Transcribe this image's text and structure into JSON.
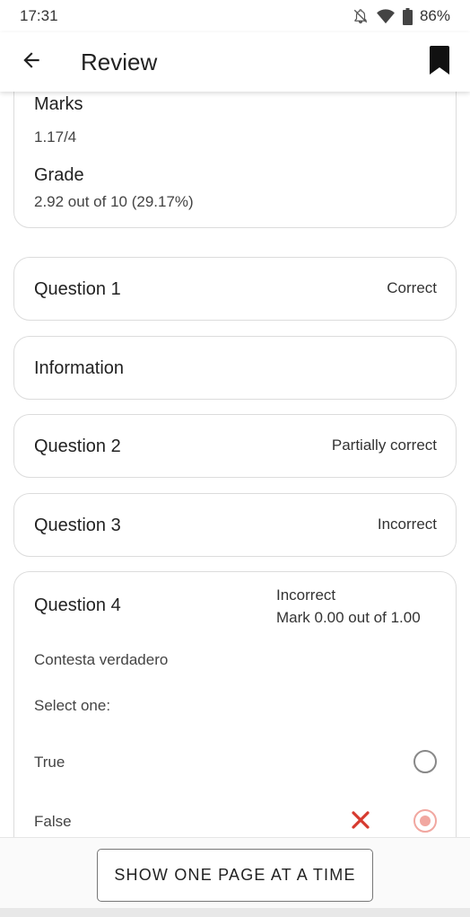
{
  "status_bar": {
    "time": "17:31",
    "battery": "86%"
  },
  "app_bar": {
    "title": "Review"
  },
  "summary": {
    "marks_label": "Marks",
    "marks_value": "1.17/4",
    "grade_label": "Grade",
    "grade_value": "2.92 out of 10 (29.17%)"
  },
  "questions": [
    {
      "title": "Question 1",
      "status": "Correct"
    },
    {
      "title": "Information",
      "status": ""
    },
    {
      "title": "Question 2",
      "status": "Partially correct"
    },
    {
      "title": "Question 3",
      "status": "Incorrect"
    }
  ],
  "question4": {
    "title": "Question 4",
    "status": "Incorrect",
    "mark": "Mark 0.00 out of 1.00",
    "text": "Contesta verdadero",
    "prompt": "Select one:",
    "options": [
      {
        "label": "True",
        "selected": false
      },
      {
        "label": "False",
        "selected": true,
        "marked_wrong": true
      }
    ]
  },
  "bottom": {
    "button_label": "SHOW ONE PAGE AT A TIME"
  },
  "colors": {
    "wrong": "#d63a2f",
    "selected_radio": "#f1a7a0"
  }
}
